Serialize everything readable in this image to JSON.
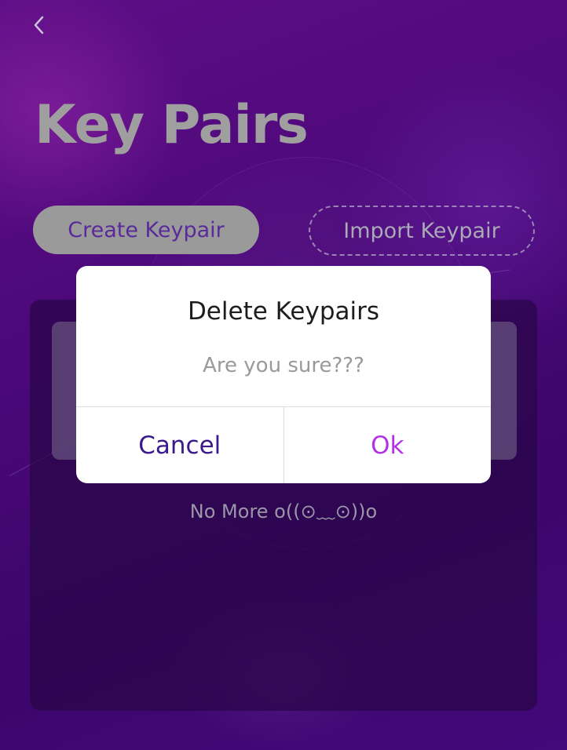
{
  "header": {
    "back_icon": "chevron-left-icon",
    "title": "Key Pairs"
  },
  "actions": {
    "create_label": "Create Keypair",
    "import_label": "Import Keypair"
  },
  "list": {
    "empty_text": "No More o((⊙﹏⊙))o"
  },
  "dialog": {
    "title": "Delete Keypairs",
    "message": "Are you sure???",
    "cancel_label": "Cancel",
    "ok_label": "Ok"
  },
  "colors": {
    "background": "#45096e",
    "ok_accent": "#b233e6",
    "cancel_accent": "#3a1a8a"
  }
}
